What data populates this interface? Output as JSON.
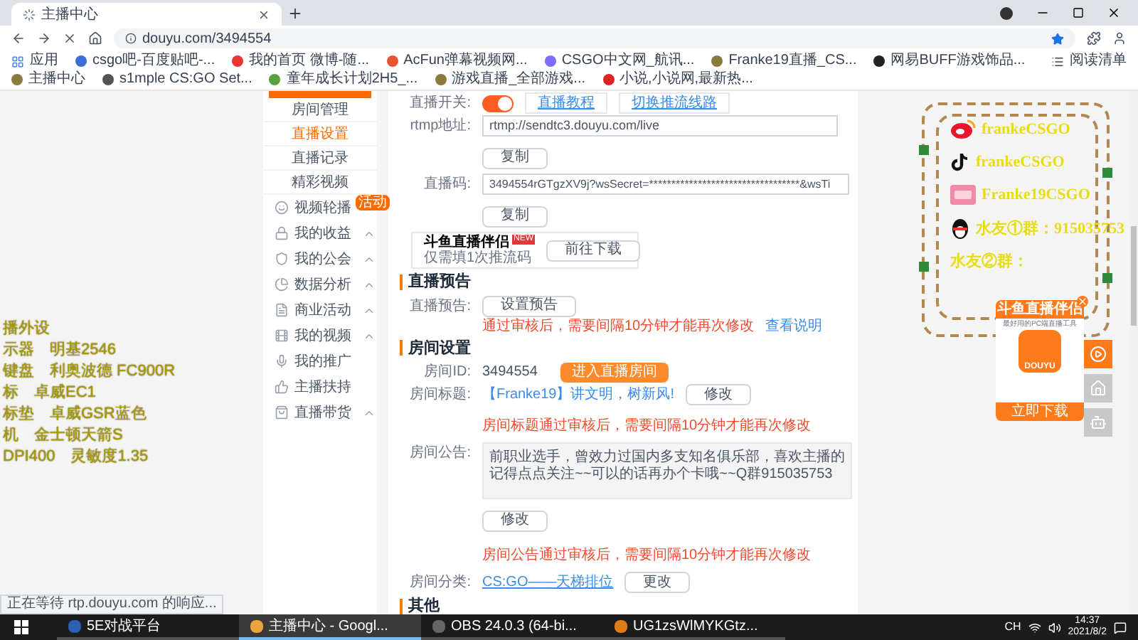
{
  "browser": {
    "tab_title": "主播中心",
    "url": "douyu.com/3494554",
    "loading": true,
    "bookmarks": [
      "应用",
      "csgo吧-百度贴吧-...",
      "我的首页 微博-随...",
      "AcFun弹幕视频网...",
      "CSGO中文网_航讯...",
      "Franke19直播_CS...",
      "网易BUFF游戏饰品...",
      "主播中心",
      "s1mple CS:GO Set...",
      "童年成长计划2H5_...",
      "游戏直播_全部游戏...",
      "小说,小说网,最新热..."
    ],
    "reading_list": "阅读清单"
  },
  "overlay": {
    "gear_lines": [
      "播外设",
      "示器　明基2546",
      "键盘　利奥波德 FC900R",
      "标　卓威EC1",
      "标垫　卓威GSR蓝色",
      "机　金士顿天箭S",
      "DPI400　灵敏度1.35"
    ],
    "social": [
      {
        "kind": "weibo",
        "handle": "frankeCSGO"
      },
      {
        "kind": "douyin",
        "handle": "frankeCSGO"
      },
      {
        "kind": "video",
        "handle": "Franke19CSGO"
      },
      {
        "kind": "qq",
        "handle": "水友①群：915035753"
      },
      {
        "kind": "plain",
        "handle": "水友②群："
      }
    ]
  },
  "promo_popup": {
    "title": "斗鱼直播伴侣",
    "subtitle": "最好用的PC端直播工具",
    "logo": "DOUYU",
    "button": "立即下载"
  },
  "sidebar": {
    "items": [
      {
        "kind": "sub",
        "label": "房间管理",
        "selected": false
      },
      {
        "kind": "sub",
        "label": "直播设置",
        "selected": true
      },
      {
        "kind": "sub",
        "label": "直播记录",
        "selected": false
      },
      {
        "kind": "sub",
        "label": "精彩视频",
        "selected": false
      },
      {
        "kind": "main",
        "label": "视频轮播",
        "collapsible": false,
        "badge": "活动"
      },
      {
        "kind": "main",
        "label": "我的收益",
        "collapsible": true
      },
      {
        "kind": "main",
        "label": "我的公会",
        "collapsible": true
      },
      {
        "kind": "main",
        "label": "数据分析",
        "collapsible": true
      },
      {
        "kind": "main",
        "label": "商业活动",
        "collapsible": true
      },
      {
        "kind": "main",
        "label": "我的视频",
        "collapsible": true
      },
      {
        "kind": "main",
        "label": "我的推广",
        "collapsible": false
      },
      {
        "kind": "main",
        "label": "主播扶持",
        "collapsible": false
      },
      {
        "kind": "main",
        "label": "直播带货",
        "collapsible": true
      }
    ]
  },
  "stream": {
    "switch_label": "直播开关:",
    "switch_on": true,
    "switch_links": [
      "直播教程",
      "切换推流线路"
    ],
    "rtmp_label": "rtmp地址:",
    "rtmp_value": "rtmp://sendtc3.douyu.com/live",
    "copy_rtmp": "复制",
    "copy_code": "复制",
    "code_label": "直播码:",
    "code_value": "3494554rGTgzXV9j?wsSecret=**********************************&wsTi",
    "companion": {
      "title": "斗鱼直播伴侣",
      "badge": "NEW",
      "subtitle": "仅需填1次推流码",
      "button": "前往下载"
    }
  },
  "preview": {
    "heading": "直播预告",
    "label": "直播预告:",
    "button": "设置预告",
    "note": "通过审核后，需要间隔10分钟才能再次修改",
    "link": "查看说明"
  },
  "room": {
    "heading": "房间设置",
    "id_label": "房间ID:",
    "id_value": "3494554",
    "enter_button": "进入直播房间",
    "title_label": "房间标题:",
    "title_value": "【Franke19】讲文明，树新风!",
    "title_button": "修改",
    "title_note": "房间标题通过审核后，需要间隔10分钟才能再次修改",
    "notice_label": "房间公告:",
    "notice_value": "前职业选手，曾效力过国内多支知名俱乐部，喜欢主播的记得点点关注~~可以的话再办个卡哦~~Q群915035753",
    "notice_button": "修改",
    "notice_note": "房间公告通过审核后，需要间隔10分钟才能再次修改",
    "category_label": "房间分类:",
    "category_value": "CS:GO——天梯排位",
    "category_button": "更改"
  },
  "other": {
    "heading": "其他"
  },
  "status_text": "正在等待 rtp.douyu.com 的响应...",
  "taskbar": {
    "apps": [
      {
        "label": "5E对战平台",
        "selected": false
      },
      {
        "label": "主播中心 - Googl...",
        "selected": true
      },
      {
        "label": "OBS 24.0.3 (64-bi...",
        "selected": false
      },
      {
        "label": "UG1zsWlMYKGtz...",
        "selected": false
      }
    ],
    "ime": "CH",
    "time": "14:37",
    "date": "2021/8/2"
  }
}
